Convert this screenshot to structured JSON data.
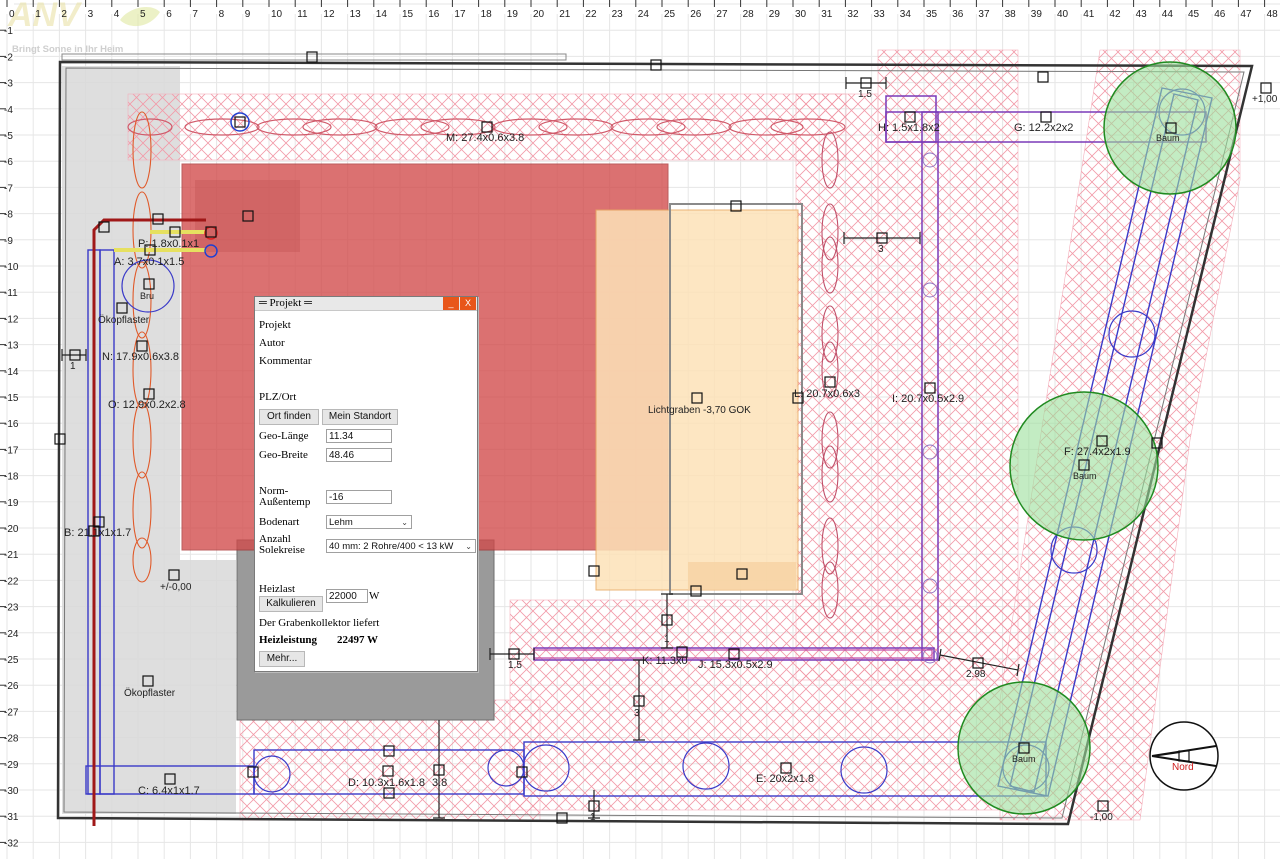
{
  "ruler": {
    "x_ticks": [
      "0",
      "1",
      "2",
      "3",
      "4",
      "5",
      "6",
      "7",
      "8",
      "9",
      "10",
      "11",
      "12",
      "13",
      "14",
      "15",
      "16",
      "17",
      "18",
      "19",
      "20",
      "21",
      "22",
      "23",
      "24",
      "25",
      "26",
      "27",
      "28",
      "29",
      "30",
      "31",
      "32",
      "33",
      "34",
      "35",
      "36",
      "37",
      "38",
      "39",
      "40",
      "41",
      "42",
      "43",
      "44",
      "45",
      "46",
      "47",
      "48"
    ],
    "y_ticks": [
      "-1",
      "-2",
      "-3",
      "-4",
      "-5",
      "-6",
      "-7",
      "-8",
      "-9",
      "-10",
      "-11",
      "-12",
      "-13",
      "-14",
      "-15",
      "-16",
      "-17",
      "-18",
      "-19",
      "-20",
      "-21",
      "-22",
      "-23",
      "-24",
      "-25",
      "-26",
      "-27",
      "-28",
      "-29",
      "-30",
      "-31",
      "-32"
    ]
  },
  "logo": {
    "tagline": "Bringt Sonne in Ihr Heim"
  },
  "plan": {
    "labels": {
      "M": "M: 27.4x0.6x3.8",
      "H": "H: 1.5x1.8x2",
      "G": "G: 12.2x2x2",
      "P": "P: 1.8x0.1x1",
      "A": "A: 3.7x0.1x1.5",
      "brunnen": "Bru",
      "oekopflaster1": "Ökopflaster",
      "N": "N: 17.9x0.6x3.8",
      "O": "O: 12.9x0.2x2.8",
      "B": "B: 21.1x1x1.7",
      "zero": "+/-0,00",
      "oekopflaster2": "Ökopflaster",
      "C": "C: 6.4x1x1.7",
      "D": "D: 10.3x1.6x1.8",
      "d38": "3.8",
      "E": "E: 20x2x1.8",
      "lichtgraben": "Lichtgraben -3,70 GOK",
      "L": "L: 20.7x0.6x3",
      "I": "I: 20.7x0.5x2.9",
      "F": "F: 27.4x2x1.9",
      "baum1": "Baum",
      "baum2": "Baum",
      "baum3": "Baum",
      "K": "K: 11.3x0",
      "J": "J: 15.3x0.5x2.9",
      "dim298": "2.98",
      "dim15a": "1.5",
      "dim15b": "1.5",
      "dim3a": "3",
      "dim3b": "3",
      "dim1": "1",
      "dim1b": "1",
      "dim1c": "1",
      "plus100": "+1,00",
      "minus100": "-1,00",
      "nord": "Nord"
    }
  },
  "dialog": {
    "title": "═ Projekt ═",
    "min_label": "_",
    "close_label": "X",
    "projekt_label": "Projekt",
    "autor_label": "Autor",
    "kommentar_label": "Kommentar",
    "plz_label": "PLZ/Ort",
    "ort_finden": "Ort finden",
    "mein_standort": "Mein Standort",
    "geo_laenge_label": "Geo-Länge",
    "geo_laenge_value": "11.34",
    "geo_breite_label": "Geo-Breite",
    "geo_breite_value": "48.46",
    "norm_label_1": "Norm-",
    "norm_label_2": "Außentemp",
    "norm_value": "-16",
    "bodenart_label": "Bodenart",
    "bodenart_value": "Lehm",
    "anzahl_label_1": "Anzahl",
    "anzahl_label_2": "Solekreise",
    "anzahl_value": "40 mm: 2 Rohre/400 < 13 kW",
    "heizlast_label": "Heizlast",
    "kalkulieren": "Kalkulieren",
    "heizlast_value": "22000",
    "heizlast_unit": "W",
    "liefert": "Der Grabenkollektor liefert",
    "heizleistung_label": "Heizleistung",
    "heizleistung_value": "22497 W",
    "mehr": "Mehr..."
  }
}
